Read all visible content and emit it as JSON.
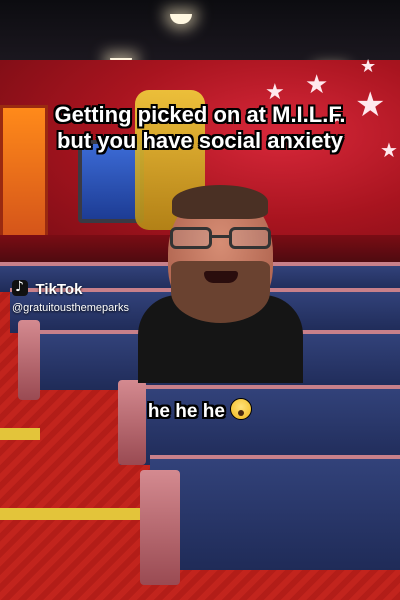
{
  "caption": {
    "top": "Getting picked on at M.I.L.F. but you have social anxiety",
    "bottom": "he he he"
  },
  "caption_emoji": "face-screaming-in-fear-icon",
  "watermark": {
    "brand": "TikTok",
    "handle": "@gratuitousthemeparks"
  },
  "colors": {
    "wall": "#a8141f",
    "carpet": "#c2241d",
    "seats": "#32427a",
    "caption_text": "#ffffff",
    "caption_outline": "#000000"
  }
}
